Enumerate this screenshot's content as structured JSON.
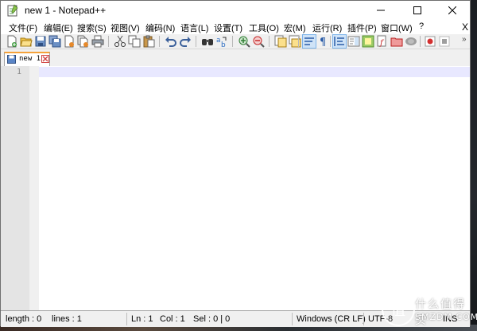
{
  "window": {
    "title": "new 1 - Notepad++",
    "controls": {
      "minimize": "minimize-icon",
      "maximize": "maximize-icon",
      "close": "close-icon"
    }
  },
  "menu": {
    "items": [
      "文件(F)",
      "编辑(E)",
      "搜索(S)",
      "视图(V)",
      "编码(N)",
      "语言(L)",
      "设置(T)",
      "工具(O)",
      "宏(M)",
      "运行(R)",
      "插件(P)",
      "窗口(W)",
      "?"
    ],
    "close_doc": "X"
  },
  "toolbar": {
    "icons": [
      "new-file-icon",
      "open-file-icon",
      "save-icon",
      "save-all-icon",
      "close-icon",
      "close-all-icon",
      "print-icon",
      "cut-icon",
      "copy-icon",
      "paste-icon",
      "undo-icon",
      "redo-icon",
      "find-icon",
      "replace-icon",
      "zoom-in-icon",
      "zoom-out-icon",
      "sync-vertical-icon",
      "sync-horizontal-icon",
      "word-wrap-icon",
      "show-all-chars-icon",
      "indent-guide-icon",
      "doc-map-icon",
      "function-list-icon",
      "folder-workspace-icon",
      "monitoring-icon",
      "record-macro-icon",
      "stop-macro-icon"
    ],
    "more": "»",
    "active_color": "#cfe3f7"
  },
  "tabs": [
    {
      "label": "new 1",
      "accent": "#f5a23a"
    }
  ],
  "editor": {
    "line_numbers": [
      "1"
    ],
    "current_line_color": "#e8e8ff"
  },
  "status": {
    "length": "length : 0",
    "lines": "lines : 1",
    "ln": "Ln : 1",
    "col": "Col : 1",
    "sel": "Sel : 0 | 0",
    "eol": "Windows (CR LF)",
    "encoding": "UTF-8",
    "mode": "INS"
  },
  "watermark": {
    "glyph": "值",
    "text": "什么值得买",
    "sub": "SMZDM.COM"
  }
}
